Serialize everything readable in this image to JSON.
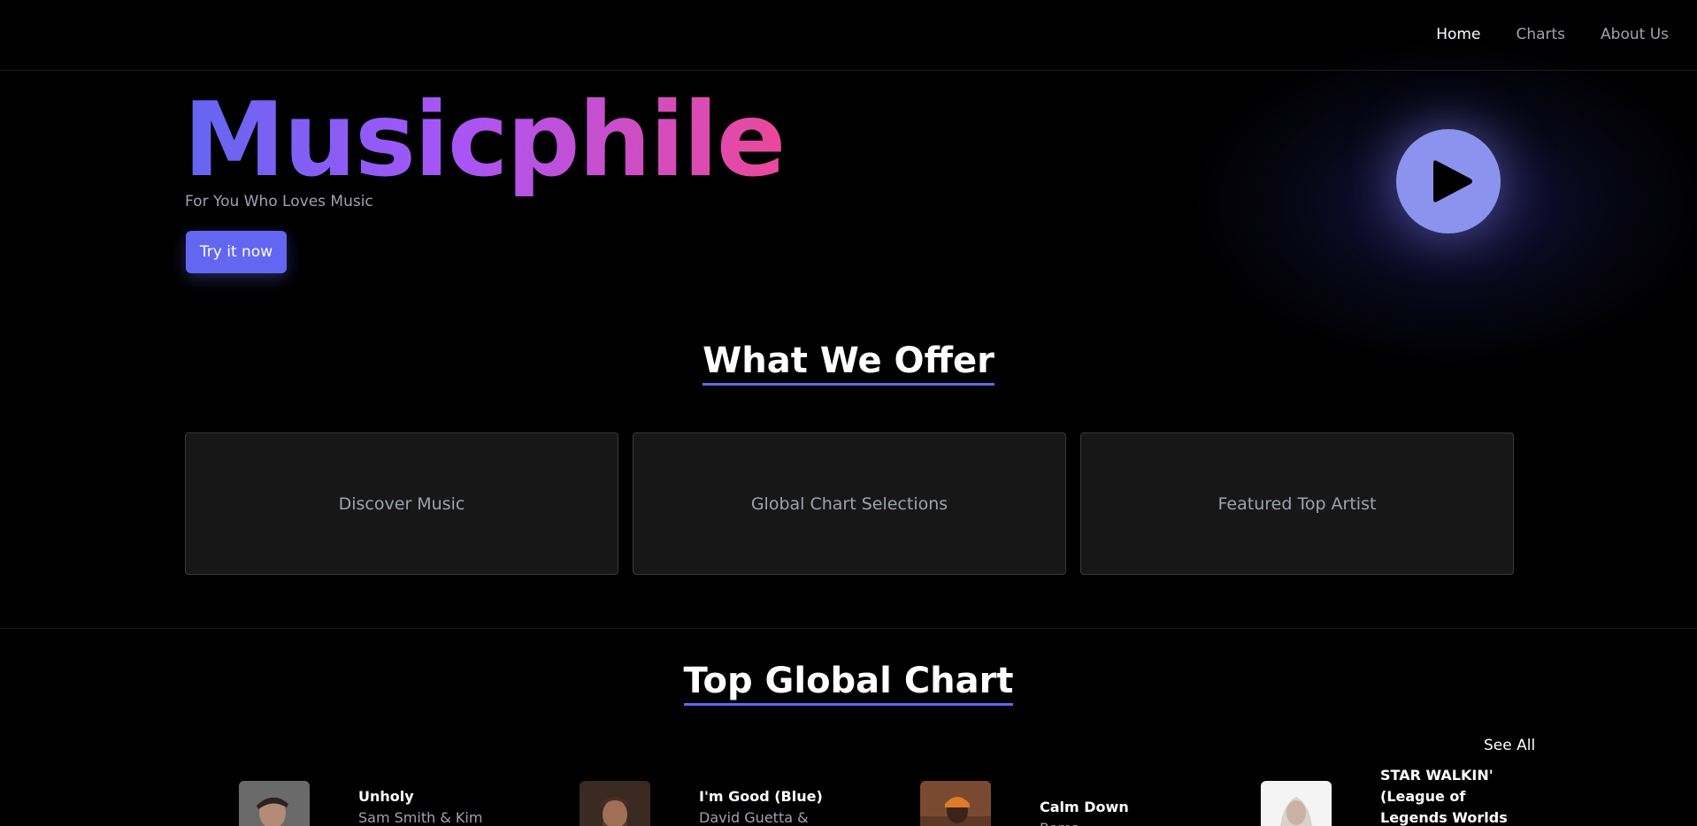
{
  "nav": {
    "items": [
      {
        "label": "Home"
      },
      {
        "label": "Charts"
      },
      {
        "label": "About Us"
      }
    ]
  },
  "hero": {
    "title": "Musicphile",
    "subtitle": "For You Who Loves Music",
    "cta_label": "Try it now",
    "icon": "play-icon"
  },
  "offer": {
    "title": "What We Offer",
    "cards": [
      {
        "label": "Discover Music"
      },
      {
        "label": "Global Chart Selections"
      },
      {
        "label": "Featured Top Artist"
      }
    ]
  },
  "chart": {
    "title": "Top Global Chart",
    "see_all": "See All",
    "tracks": [
      {
        "name": "Unholy",
        "artist": "Sam Smith & Kim"
      },
      {
        "name": "I'm Good (Blue)",
        "artist": "David Guetta &"
      },
      {
        "name": "Calm Down",
        "artist": "Rema"
      },
      {
        "name": "STAR WALKIN' (League of Legends Worlds",
        "artist": ""
      }
    ]
  },
  "colors": {
    "accent": "#6366f1",
    "gradient_start": "#6366f1",
    "gradient_mid": "#a855f7",
    "gradient_end": "#ec4899",
    "card_bg": "#171717"
  }
}
